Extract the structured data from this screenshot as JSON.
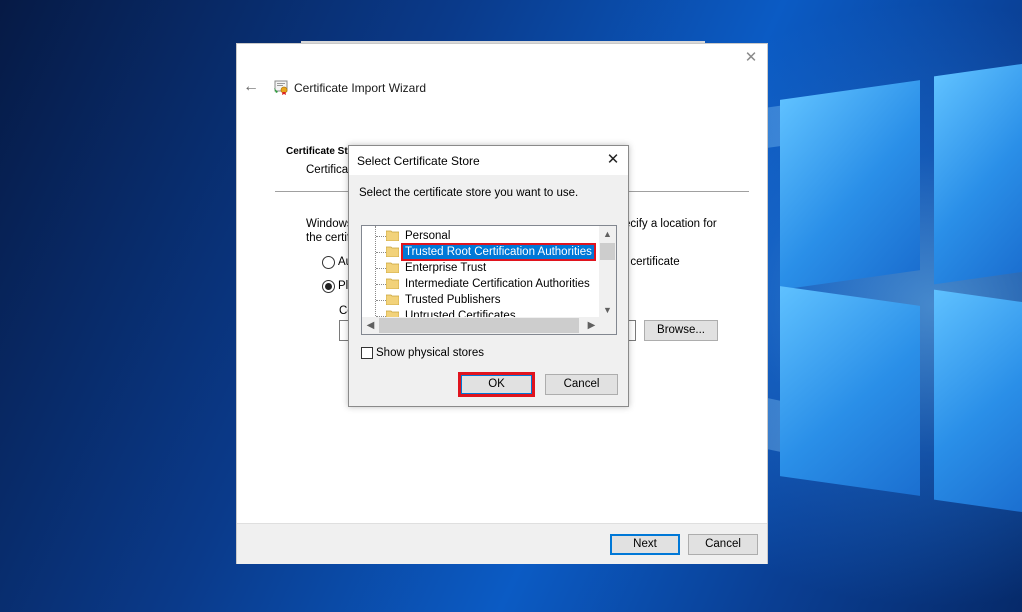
{
  "wizard": {
    "title": "Certificate Import Wizard",
    "store_heading": "Certificate Sto",
    "store_sub": "Certificat",
    "desc_line1": "Windows",
    "desc_line2": "the certif",
    "desc_right1": "ecify a location for",
    "desc_right2": "f certificate",
    "radio_auto": "Au",
    "radio_place": "Pla",
    "store_label": "Ce",
    "browse_label": "Browse...",
    "next_label": "Next",
    "cancel_label": "Cancel",
    "back_icon": "back-arrow-icon",
    "close_icon": "close-icon"
  },
  "dialog": {
    "title": "Select Certificate Store",
    "prompt": "Select the certificate store you want to use.",
    "stores": [
      {
        "label": "Personal",
        "selected": false
      },
      {
        "label": "Trusted Root Certification Authorities",
        "selected": true
      },
      {
        "label": "Enterprise Trust",
        "selected": false
      },
      {
        "label": "Intermediate Certification Authorities",
        "selected": false
      },
      {
        "label": "Trusted Publishers",
        "selected": false
      },
      {
        "label": "Untrusted Certificates",
        "selected": false
      }
    ],
    "show_physical_label": "Show physical stores",
    "show_physical_checked": false,
    "ok_label": "OK",
    "cancel_label": "Cancel"
  },
  "colors": {
    "selection": "#0078d7",
    "highlight_box": "#e0141e",
    "button_face": "#e1e1e1"
  }
}
